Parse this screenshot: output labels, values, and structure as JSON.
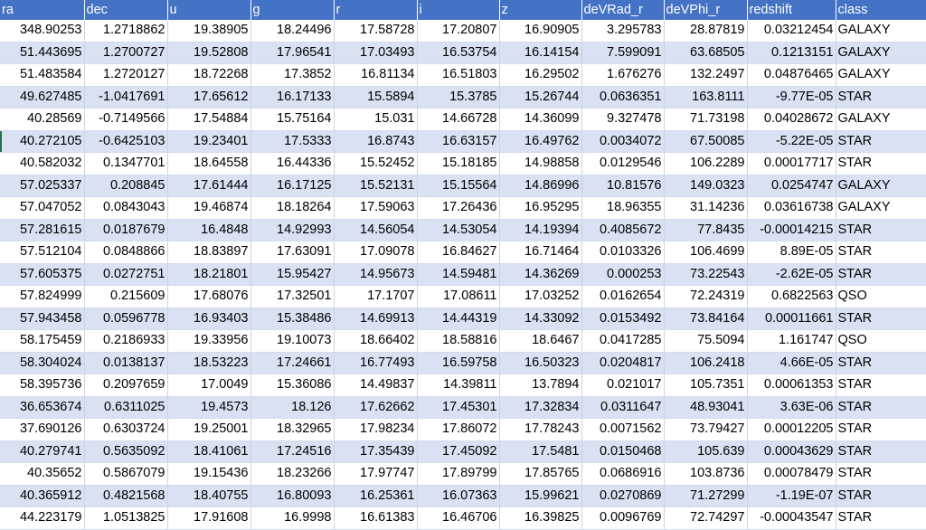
{
  "columns": [
    "ra",
    "dec",
    "u",
    "g",
    "r",
    "i",
    "z",
    "deVRad_r",
    "deVPhi_r",
    "redshift",
    "class"
  ],
  "rows": [
    [
      "348.90253",
      "1.2718862",
      "19.38905",
      "18.24496",
      "17.58728",
      "17.20807",
      "16.90905",
      "3.295783",
      "28.87819",
      "0.03212454",
      "GALAXY"
    ],
    [
      "51.443695",
      "1.2700727",
      "19.52808",
      "17.96541",
      "17.03493",
      "16.53754",
      "16.14154",
      "7.599091",
      "63.68505",
      "0.1213151",
      "GALAXY"
    ],
    [
      "51.483584",
      "1.2720127",
      "18.72268",
      "17.3852",
      "16.81134",
      "16.51803",
      "16.29502",
      "1.676276",
      "132.2497",
      "0.04876465",
      "GALAXY"
    ],
    [
      "49.627485",
      "-1.0417691",
      "17.65612",
      "16.17133",
      "15.5894",
      "15.3785",
      "15.26744",
      "0.0636351",
      "163.8111",
      "-9.77E-05",
      "STAR"
    ],
    [
      "40.28569",
      "-0.7149566",
      "17.54884",
      "15.75164",
      "15.031",
      "14.66728",
      "14.36099",
      "9.327478",
      "71.73198",
      "0.04028672",
      "GALAXY"
    ],
    [
      "40.272105",
      "-0.6425103",
      "19.23401",
      "17.5333",
      "16.8743",
      "16.63157",
      "16.49762",
      "0.0034072",
      "67.50085",
      "-5.22E-05",
      "STAR"
    ],
    [
      "40.582032",
      "0.1347701",
      "18.64558",
      "16.44336",
      "15.52452",
      "15.18185",
      "14.98858",
      "0.0129546",
      "106.2289",
      "0.00017717",
      "STAR"
    ],
    [
      "57.025337",
      "0.208845",
      "17.61444",
      "16.17125",
      "15.52131",
      "15.15564",
      "14.86996",
      "10.81576",
      "149.0323",
      "0.0254747",
      "GALAXY"
    ],
    [
      "57.047052",
      "0.0843043",
      "19.46874",
      "18.18264",
      "17.59063",
      "17.26436",
      "16.95295",
      "18.96355",
      "31.14236",
      "0.03616738",
      "GALAXY"
    ],
    [
      "57.281615",
      "0.0187679",
      "16.4848",
      "14.92993",
      "14.56054",
      "14.53054",
      "14.19394",
      "0.4085672",
      "77.8435",
      "-0.00014215",
      "STAR"
    ],
    [
      "57.512104",
      "0.0848866",
      "18.83897",
      "17.63091",
      "17.09078",
      "16.84627",
      "16.71464",
      "0.0103326",
      "106.4699",
      "8.89E-05",
      "STAR"
    ],
    [
      "57.605375",
      "0.0272751",
      "18.21801",
      "15.95427",
      "14.95673",
      "14.59481",
      "14.36269",
      "0.000253",
      "73.22543",
      "-2.62E-05",
      "STAR"
    ],
    [
      "57.824999",
      "0.215609",
      "17.68076",
      "17.32501",
      "17.1707",
      "17.08611",
      "17.03252",
      "0.0162654",
      "72.24319",
      "0.6822563",
      "QSO"
    ],
    [
      "57.943458",
      "0.0596778",
      "16.93403",
      "15.38486",
      "14.69913",
      "14.44319",
      "14.33092",
      "0.0153492",
      "73.84164",
      "0.00011661",
      "STAR"
    ],
    [
      "58.175459",
      "0.2186933",
      "19.33956",
      "19.10073",
      "18.66402",
      "18.58816",
      "18.6467",
      "0.0417285",
      "75.5094",
      "1.161747",
      "QSO"
    ],
    [
      "58.304024",
      "0.0138137",
      "18.53223",
      "17.24661",
      "16.77493",
      "16.59758",
      "16.50323",
      "0.0204817",
      "106.2418",
      "4.66E-05",
      "STAR"
    ],
    [
      "58.395736",
      "0.2097659",
      "17.0049",
      "15.36086",
      "14.49837",
      "14.39811",
      "13.7894",
      "0.021017",
      "105.7351",
      "0.00061353",
      "STAR"
    ],
    [
      "36.653674",
      "0.6311025",
      "19.4573",
      "18.126",
      "17.62662",
      "17.45301",
      "17.32834",
      "0.0311647",
      "48.93041",
      "3.63E-06",
      "STAR"
    ],
    [
      "37.690126",
      "0.6303724",
      "19.25001",
      "18.32965",
      "17.98234",
      "17.86072",
      "17.78243",
      "0.0071562",
      "73.79427",
      "0.00012205",
      "STAR"
    ],
    [
      "40.279741",
      "0.5635092",
      "18.41061",
      "17.24516",
      "17.35439",
      "17.45092",
      "17.5481",
      "0.0150468",
      "105.639",
      "0.00043629",
      "STAR"
    ],
    [
      "40.35652",
      "0.5867079",
      "19.15436",
      "18.23266",
      "17.97747",
      "17.89799",
      "17.85765",
      "0.0686916",
      "103.8736",
      "0.00078479",
      "STAR"
    ],
    [
      "40.365912",
      "0.4821568",
      "18.40755",
      "16.80093",
      "16.25361",
      "16.07363",
      "15.99621",
      "0.0270869",
      "71.27299",
      "-1.19E-07",
      "STAR"
    ],
    [
      "44.223179",
      "1.0513825",
      "17.91608",
      "16.9998",
      "16.61383",
      "16.46706",
      "16.39825",
      "0.0096769",
      "72.74297",
      "-0.00043547",
      "STAR"
    ]
  ]
}
